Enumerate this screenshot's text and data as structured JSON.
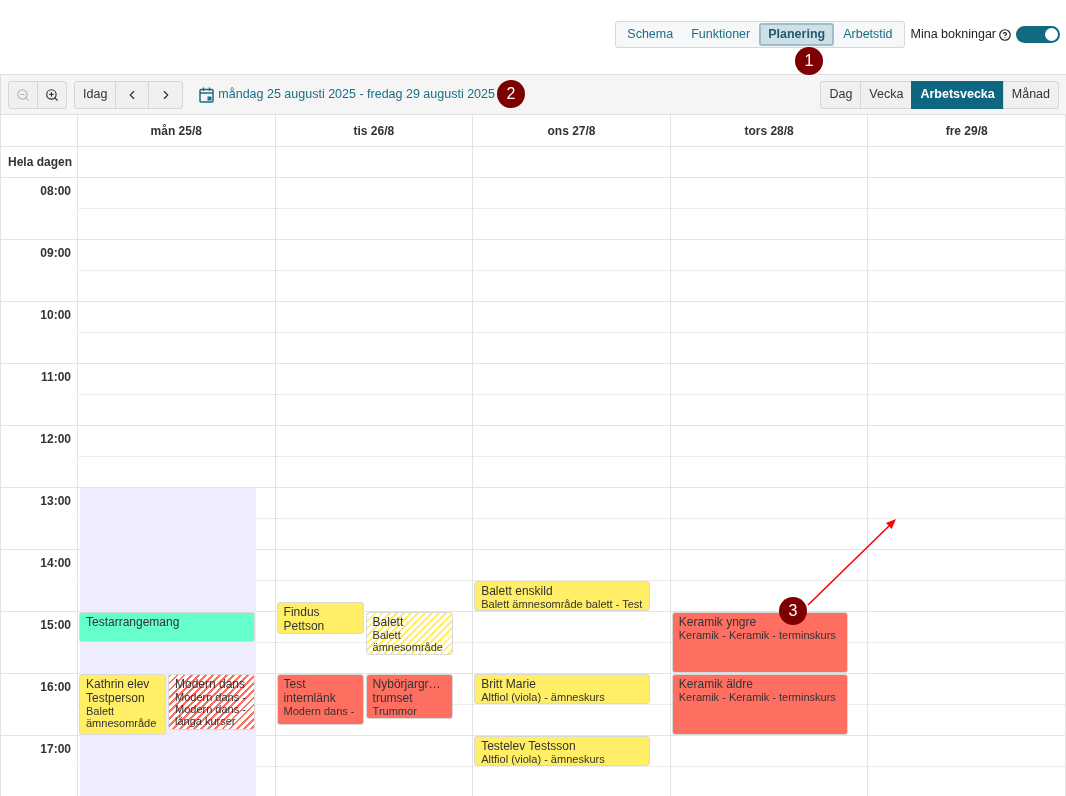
{
  "top_nav": {
    "tabs": [
      {
        "label": "Schema",
        "selected": false
      },
      {
        "label": "Funktioner",
        "selected": false
      },
      {
        "label": "Planering",
        "selected": true
      },
      {
        "label": "Arbetstid",
        "selected": false
      }
    ],
    "my_bookings": {
      "label": "Mina bokningar",
      "on": true
    }
  },
  "toolbar": {
    "zoom_buttons": [
      {
        "kind": "zoom_out",
        "disabled": true
      },
      {
        "kind": "zoom_in",
        "disabled": false
      }
    ],
    "today_button": "Idag",
    "date_range": "måndag 25 augusti 2025 - fredag 29 augusti 2025",
    "views": [
      {
        "label": "Dag",
        "selected": false
      },
      {
        "label": "Vecka",
        "selected": false
      },
      {
        "label": "Arbetsvecka",
        "selected": true
      },
      {
        "label": "Månad",
        "selected": false
      }
    ]
  },
  "calendar": {
    "all_day_label": "Hela dagen",
    "hours": [
      "08:00",
      "09:00",
      "10:00",
      "11:00",
      "12:00",
      "13:00",
      "14:00",
      "15:00",
      "16:00",
      "17:00"
    ],
    "days": [
      {
        "label": "mån 25/8",
        "highlighted": true,
        "events": [
          {
            "title": "Testarrangemang",
            "color": "#66ffcc",
            "striped": false
          },
          {
            "title": "Kathrin elev Testperson",
            "subtitle": "Balett ämnesområde",
            "color": "#ffee66",
            "striped": false
          },
          {
            "title": "Modern dans",
            "subtitle": "Modern dans - Modern dans - långa kurser",
            "color": "#ff6f61",
            "striped": true
          }
        ]
      },
      {
        "label": "tis 26/8",
        "events": [
          {
            "title": "Findus Pettson",
            "color": "#ffee66",
            "striped": false
          },
          {
            "title": "Balett",
            "subtitle": "Balett ämnesområde",
            "color": "#ffee66",
            "striped": true
          },
          {
            "title": "Test internlänk",
            "subtitle": "Modern dans -",
            "color": "#ff6f61",
            "striped": false
          },
          {
            "title": "Nybörjargr… trumset",
            "subtitle": "Trummor",
            "color": "#ff6f61",
            "striped": false
          }
        ]
      },
      {
        "label": "ons 27/8",
        "events": [
          {
            "title": "Balett enskild",
            "subtitle": "Balett ämnesområde balett - Test",
            "color": "#ffee66",
            "striped": false
          },
          {
            "title": "Britt Marie",
            "subtitle": "Altfiol (viola) - ämneskurs",
            "color": "#ffee66",
            "striped": false
          },
          {
            "title": "Testelev Testsson",
            "subtitle": "Altfiol (viola) - ämneskurs",
            "color": "#ffee66",
            "striped": false
          }
        ]
      },
      {
        "label": "tors 28/8",
        "events": [
          {
            "title": "Keramik yngre",
            "subtitle": "Keramik - Keramik - terminskurs",
            "color": "#ff6f61",
            "striped": false
          },
          {
            "title": "Keramik äldre",
            "subtitle": "Keramik - Keramik - terminskurs",
            "color": "#ff6f61",
            "striped": false
          }
        ]
      },
      {
        "label": "fre 29/8"
      }
    ]
  },
  "annotations": [
    "1",
    "2",
    "3"
  ]
}
